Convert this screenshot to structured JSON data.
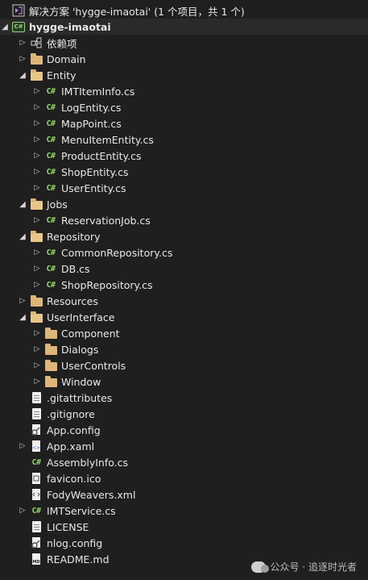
{
  "solution": {
    "label": "解决方案 'hygge-imaotai' (1 个项目，共 1 个)"
  },
  "project": {
    "label": "hygge-imaotai"
  },
  "items": [
    {
      "label": "依赖项",
      "type": "deps",
      "level": 1,
      "chevron": "collapsed"
    },
    {
      "label": "Domain",
      "type": "folder",
      "level": 1,
      "chevron": "collapsed"
    },
    {
      "label": "Entity",
      "type": "folder-open",
      "level": 1,
      "chevron": "expanded"
    },
    {
      "label": "IMTItemInfo.cs",
      "type": "cs",
      "level": 2,
      "chevron": "collapsed"
    },
    {
      "label": "LogEntity.cs",
      "type": "cs",
      "level": 2,
      "chevron": "collapsed"
    },
    {
      "label": "MapPoint.cs",
      "type": "cs",
      "level": 2,
      "chevron": "collapsed"
    },
    {
      "label": "MenuItemEntity.cs",
      "type": "cs",
      "level": 2,
      "chevron": "collapsed"
    },
    {
      "label": "ProductEntity.cs",
      "type": "cs",
      "level": 2,
      "chevron": "collapsed"
    },
    {
      "label": "ShopEntity.cs",
      "type": "cs",
      "level": 2,
      "chevron": "collapsed"
    },
    {
      "label": "UserEntity.cs",
      "type": "cs",
      "level": 2,
      "chevron": "collapsed"
    },
    {
      "label": "Jobs",
      "type": "folder-open",
      "level": 1,
      "chevron": "expanded"
    },
    {
      "label": "ReservationJob.cs",
      "type": "cs",
      "level": 2,
      "chevron": "collapsed"
    },
    {
      "label": "Repository",
      "type": "folder-open",
      "level": 1,
      "chevron": "expanded"
    },
    {
      "label": "CommonRepository.cs",
      "type": "cs",
      "level": 2,
      "chevron": "collapsed"
    },
    {
      "label": "DB.cs",
      "type": "cs",
      "level": 2,
      "chevron": "collapsed"
    },
    {
      "label": "ShopRepository.cs",
      "type": "cs",
      "level": 2,
      "chevron": "collapsed"
    },
    {
      "label": "Resources",
      "type": "folder",
      "level": 1,
      "chevron": "collapsed"
    },
    {
      "label": "UserInterface",
      "type": "folder-open",
      "level": 1,
      "chevron": "expanded"
    },
    {
      "label": "Component",
      "type": "folder",
      "level": 2,
      "chevron": "collapsed"
    },
    {
      "label": "Dialogs",
      "type": "folder",
      "level": 2,
      "chevron": "collapsed"
    },
    {
      "label": "UserControls",
      "type": "folder",
      "level": 2,
      "chevron": "collapsed"
    },
    {
      "label": "Window",
      "type": "folder",
      "level": 2,
      "chevron": "collapsed"
    },
    {
      "label": ".gitattributes",
      "type": "file",
      "level": 1,
      "chevron": "none"
    },
    {
      "label": ".gitignore",
      "type": "file",
      "level": 1,
      "chevron": "none"
    },
    {
      "label": "App.config",
      "type": "config",
      "level": 1,
      "chevron": "none"
    },
    {
      "label": "App.xaml",
      "type": "xaml",
      "level": 1,
      "chevron": "collapsed"
    },
    {
      "label": "AssemblyInfo.cs",
      "type": "cs",
      "level": 1,
      "chevron": "none"
    },
    {
      "label": "favicon.ico",
      "type": "ico",
      "level": 1,
      "chevron": "none"
    },
    {
      "label": "FodyWeavers.xml",
      "type": "xml",
      "level": 1,
      "chevron": "none"
    },
    {
      "label": "IMTService.cs",
      "type": "cs",
      "level": 1,
      "chevron": "collapsed"
    },
    {
      "label": "LICENSE",
      "type": "file",
      "level": 1,
      "chevron": "none"
    },
    {
      "label": "nlog.config",
      "type": "config",
      "level": 1,
      "chevron": "none"
    },
    {
      "label": "README.md",
      "type": "md",
      "level": 1,
      "chevron": "none"
    }
  ],
  "watermark": {
    "text": "公众号 · 追逐时光者"
  },
  "colors": {
    "background": "#1f1f1f",
    "text": "#e8e8e8",
    "folder": "#dcb67a",
    "csharp": "#8fd96b"
  }
}
